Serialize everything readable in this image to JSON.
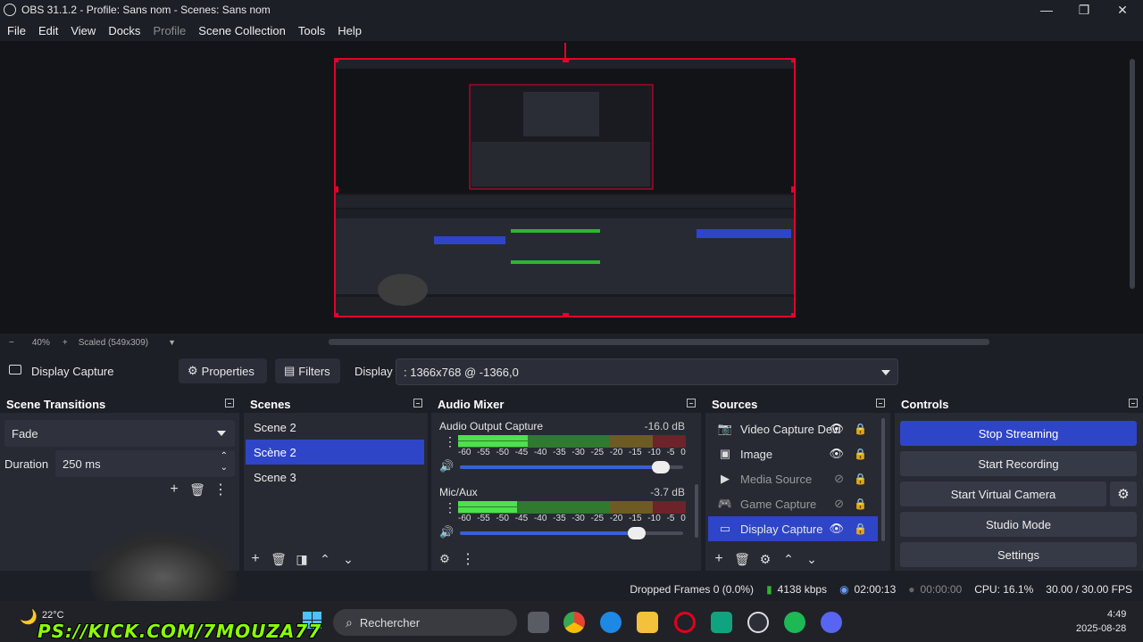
{
  "window": {
    "title": "OBS 31.1.2 - Profile: Sans nom - Scenes: Sans nom",
    "minimize_icon": "minimize-icon",
    "maximize_icon": "restore-icon",
    "close_icon": "close-icon"
  },
  "menu": [
    "File",
    "Edit",
    "View",
    "Docks",
    "Profile",
    "Scene Collection",
    "Tools",
    "Help"
  ],
  "preview": {
    "zoom_minus": "−",
    "zoom_level": "40%",
    "zoom_plus": "+",
    "scaled_label": "Scaled (549x309)"
  },
  "context_bar": {
    "source_name": "Display Capture",
    "properties_label": "Properties",
    "filters_label": "Filters",
    "display_label": "Display",
    "display_value": ": 1366x768 @ -1366,0"
  },
  "scene_transitions": {
    "title": "Scene Transitions",
    "transition": "Fade",
    "duration_label": "Duration",
    "duration_value": "250 ms"
  },
  "scenes": {
    "title": "Scenes",
    "items": [
      "Scene 2",
      "Scène 2",
      "Scene 3"
    ],
    "selected_index": 1
  },
  "audio_mixer": {
    "title": "Audio Mixer",
    "ticks": [
      "-60",
      "-55",
      "-50",
      "-45",
      "-40",
      "-35",
      "-30",
      "-25",
      "-20",
      "-15",
      "-10",
      "-5",
      "0"
    ],
    "channels": [
      {
        "name": "Audio Output Capture",
        "level": "-16.0 dB",
        "volume": 0.9
      },
      {
        "name": "Mic/Aux",
        "level": "-3.7 dB",
        "volume": 0.79
      }
    ]
  },
  "sources": {
    "title": "Sources",
    "items": [
      {
        "name": "Video Capture Devic",
        "icon": "camera-icon",
        "visible": true
      },
      {
        "name": "Image",
        "icon": "image-icon",
        "visible": true
      },
      {
        "name": "Media Source",
        "icon": "play-icon",
        "visible": false
      },
      {
        "name": "Game Capture",
        "icon": "gamepad-icon",
        "visible": false
      },
      {
        "name": "Display Capture",
        "icon": "monitor-icon",
        "visible": true
      }
    ],
    "selected_index": 4
  },
  "controls": {
    "title": "Controls",
    "stop_streaming": "Stop Streaming",
    "start_recording": "Start Recording",
    "start_virtual_camera": "Start Virtual Camera",
    "studio_mode": "Studio Mode",
    "settings": "Settings"
  },
  "status": {
    "dropped_frames": "Dropped Frames 0 (0.0%)",
    "bitrate": "4138 kbps",
    "stream_time": "02:00:13",
    "record_time": "00:00:00",
    "cpu": "CPU: 16.1%",
    "fps": "30.00 / 30.00 FPS"
  },
  "taskbar": {
    "weather": "22°C",
    "search_placeholder": "Rechercher",
    "time": "4:49",
    "date": "2025-08-28"
  },
  "overlay": {
    "text": "PS://KICK.COM/7MOUZA77"
  },
  "colors": {
    "accent": "#2f45c7",
    "selection_border": "#e4002b",
    "meter_green": "#2fb52f",
    "meter_yellow": "#b59a2f",
    "meter_red": "#b52f3a",
    "overlay_green": "#8cff00"
  }
}
